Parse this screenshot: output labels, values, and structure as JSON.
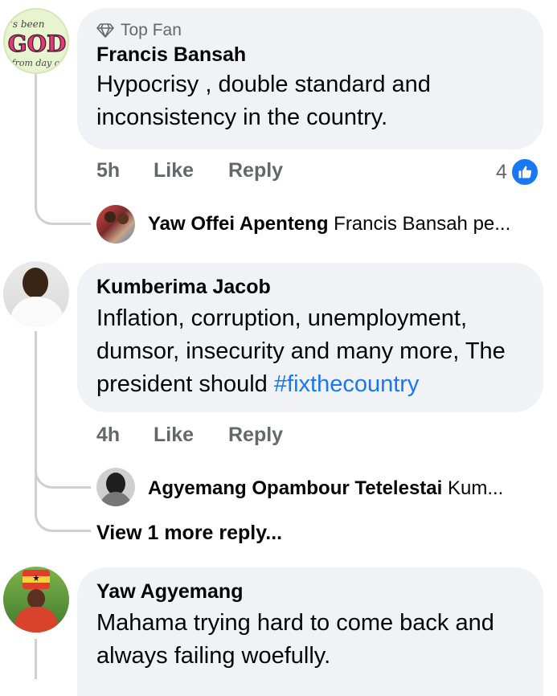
{
  "comments": [
    {
      "badge": "Top Fan",
      "author": "Francis Bansah",
      "text": "Hypocrisy , double standard and inconsistency in the country.",
      "time": "5h",
      "like_label": "Like",
      "reply_label": "Reply",
      "reaction_count": "4",
      "avatar_text": {
        "top": "'s been",
        "main": "GOD",
        "bottom": "from day on"
      },
      "reply": {
        "author": "Yaw Offei Apenteng",
        "preview": "Francis Bansah pe..."
      }
    },
    {
      "author": "Kumberima Jacob",
      "text": "Inflation, corruption, unemployment, dumsor, insecurity and many more, The president should",
      "hashtag": "#fixthecountry",
      "time": "4h",
      "like_label": "Like",
      "reply_label": "Reply",
      "reply": {
        "author": "Agyemang Opambour Tetelestai",
        "preview": "Kum..."
      },
      "view_more": "View 1 more reply..."
    },
    {
      "author": "Yaw Agyemang",
      "text": "Mahama trying hard to come back and always failing woefully."
    }
  ],
  "colors": {
    "bubble": "#f0f2f5",
    "meta": "#65676b",
    "link": "#1877f2",
    "thread_line": "#ced0d4",
    "like_icon_bg": "#1877f2"
  },
  "icons": {
    "badge": "diamond-icon",
    "reaction": "thumbs-up-icon"
  }
}
